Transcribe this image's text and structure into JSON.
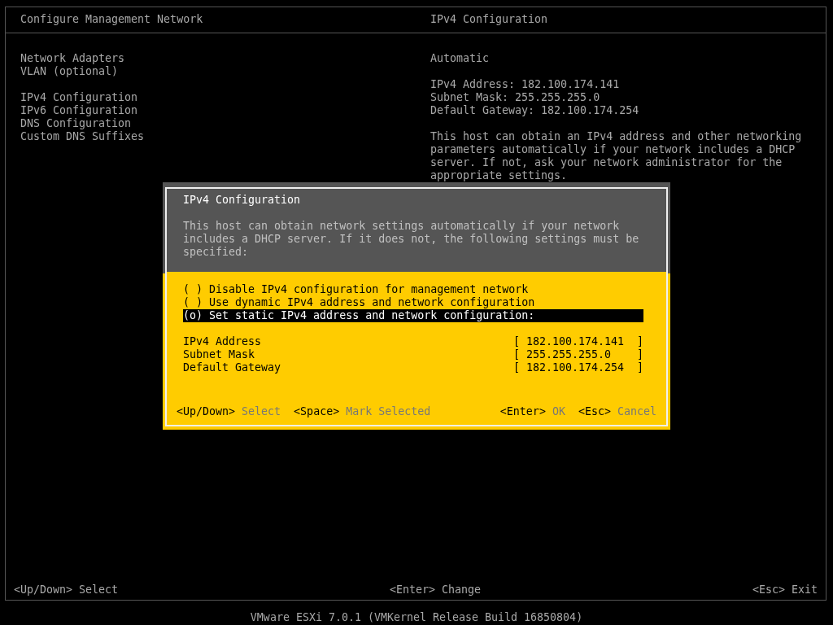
{
  "screen": {
    "title": "Configure Management Network",
    "detail_title": "IPv4 Configuration"
  },
  "menu_groups": [
    {
      "items": [
        {
          "label": "Network Adapters"
        },
        {
          "label": "VLAN (optional)"
        }
      ]
    },
    {
      "items": [
        {
          "label": "IPv4 Configuration"
        },
        {
          "label": "IPv6 Configuration"
        },
        {
          "label": "DNS Configuration"
        },
        {
          "label": "Custom DNS Suffixes"
        }
      ]
    }
  ],
  "detail": {
    "mode": "Automatic",
    "lines": [
      "IPv4 Address: 182.100.174.141",
      "Subnet Mask: 255.255.255.0",
      "Default Gateway: 182.100.174.254"
    ],
    "description": "This host can obtain an IPv4 address and other networking parameters automatically if your network includes a DHCP server. If not, ask your network administrator for the appropriate settings."
  },
  "dialog": {
    "title": "IPv4 Configuration",
    "description": "This host can obtain network settings automatically if your network includes a DHCP server. If it does not, the following settings must be specified:",
    "options": [
      {
        "marker": "( )",
        "label": "Disable IPv4 configuration for management network",
        "selected": false
      },
      {
        "marker": "( )",
        "label": "Use dynamic IPv4 address and network configuration",
        "selected": false
      },
      {
        "marker": "(o)",
        "label": "Set static IPv4 address and network configuration:",
        "selected": true
      }
    ],
    "fields": [
      {
        "label": "IPv4 Address",
        "value": "[ 182.100.174.141  ]"
      },
      {
        "label": "Subnet Mask",
        "value": "[ 255.255.255.0    ]"
      },
      {
        "label": "Default Gateway",
        "value": "[ 182.100.174.254  ]"
      }
    ],
    "hints_left": [
      {
        "key": "<Up/Down>",
        "action": "Select"
      },
      {
        "key": "<Space>",
        "action": "Mark Selected"
      }
    ],
    "hints_right": [
      {
        "key": "<Enter>",
        "action": "OK"
      },
      {
        "key": "<Esc>",
        "action": "Cancel"
      }
    ]
  },
  "bottom_bar": [
    {
      "key": "<Up/Down>",
      "action": "Select"
    },
    {
      "key": "<Enter>",
      "action": "Change"
    },
    {
      "key": "<Esc>",
      "action": "Exit"
    }
  ],
  "footer": "VMware ESXi 7.0.1 (VMKernel Release Build 16850804)"
}
